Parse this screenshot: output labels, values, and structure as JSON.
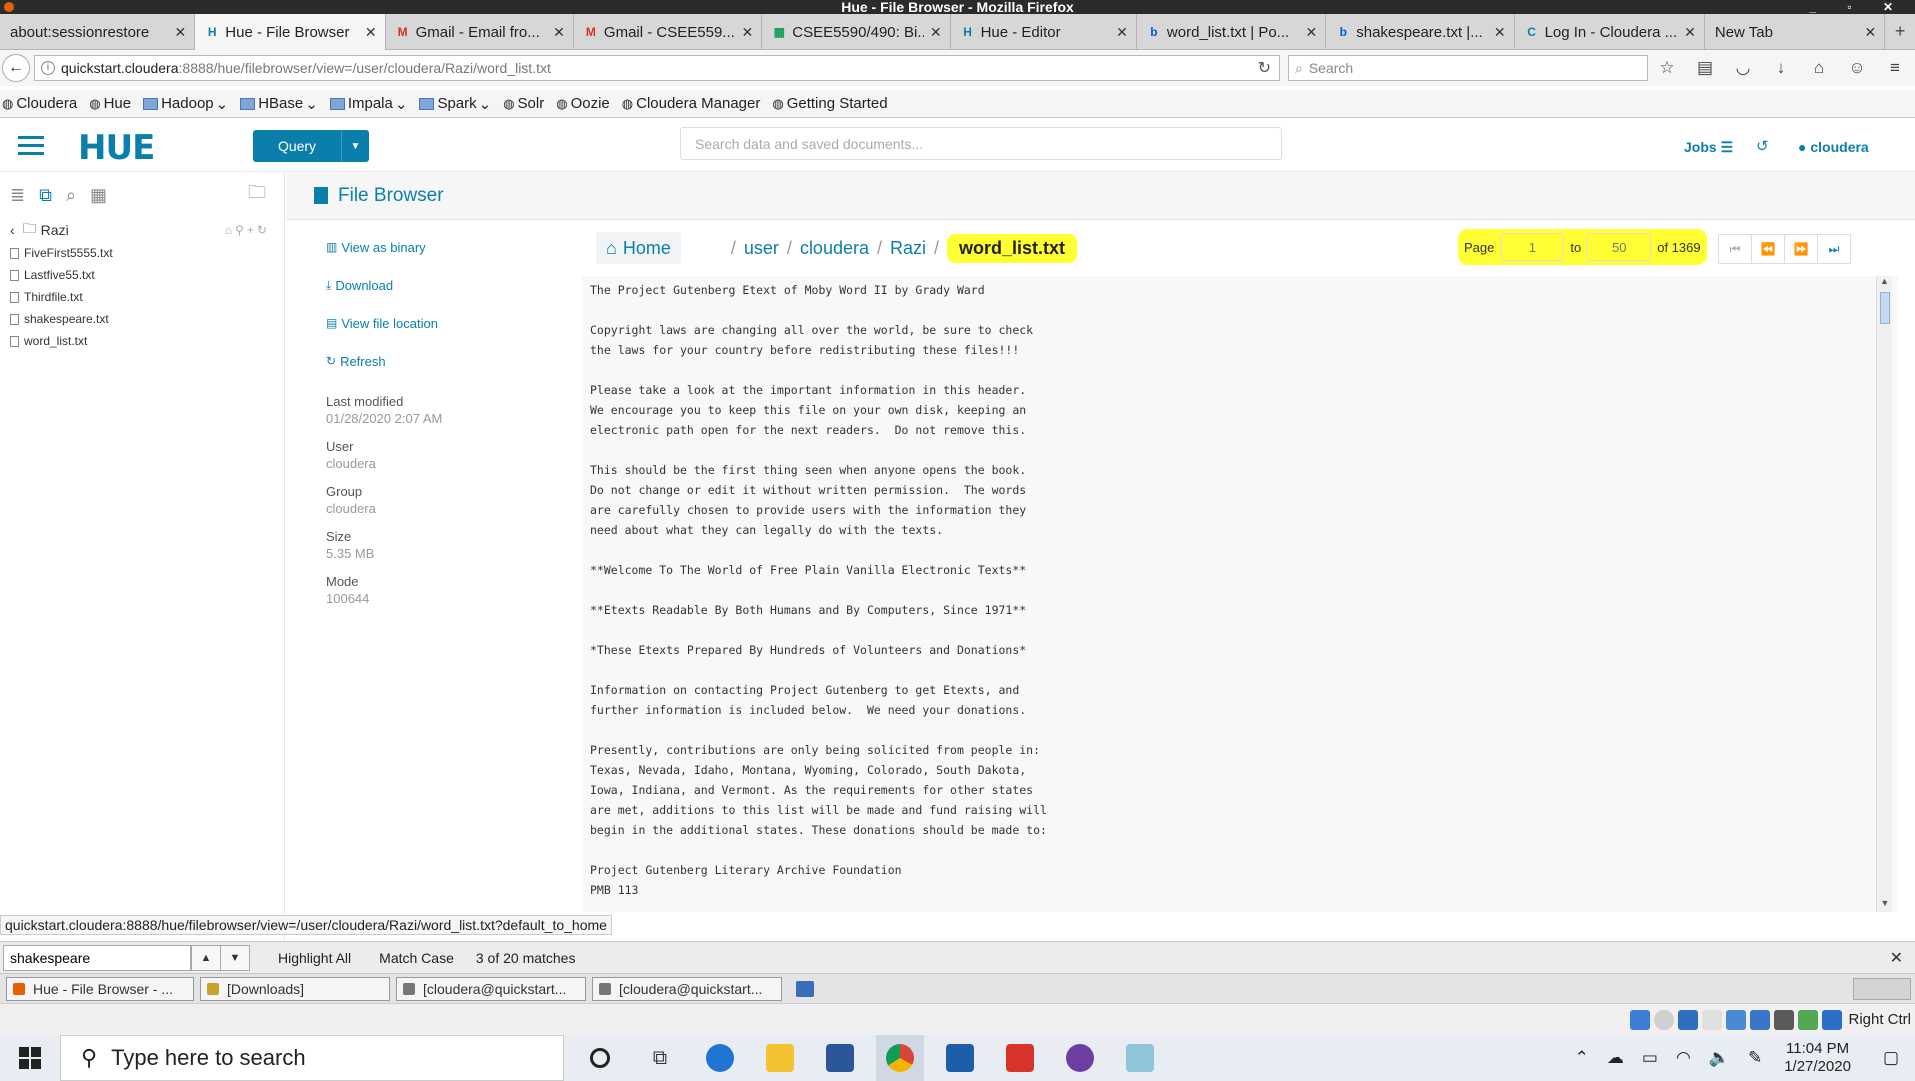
{
  "window": {
    "title": "Hue - File Browser - Mozilla Firefox"
  },
  "tabs": [
    {
      "label": "about:sessionrestore",
      "icon": "none",
      "color": ""
    },
    {
      "label": "Hue - File Browser",
      "icon": "hue",
      "color": "#0b7fab",
      "active": true
    },
    {
      "label": "Gmail - Email fro...",
      "icon": "gmail",
      "color": "#d93025"
    },
    {
      "label": "Gmail - CSEE559...",
      "icon": "gmail",
      "color": "#d93025"
    },
    {
      "label": "CSEE5590/490: Bi...",
      "icon": "sheets",
      "color": "#0f9d58"
    },
    {
      "label": "Hue - Editor",
      "icon": "hue",
      "color": "#0b7fab"
    },
    {
      "label": "word_list.txt | Po...",
      "icon": "box",
      "color": "#0061d5"
    },
    {
      "label": "shakespeare.txt |...",
      "icon": "box",
      "color": "#0061d5"
    },
    {
      "label": "Log In - Cloudera ...",
      "icon": "cloudera",
      "color": "#0b7fab"
    },
    {
      "label": "New Tab",
      "icon": "none",
      "color": ""
    }
  ],
  "url": {
    "host": "quickstart.cloudera",
    "path": ":8888/hue/filebrowser/view=/user/cloudera/Razi/word_list.txt"
  },
  "browser_search": {
    "placeholder": "Search"
  },
  "bookmarks": [
    {
      "label": "Cloudera",
      "type": "site"
    },
    {
      "label": "Hue",
      "type": "site"
    },
    {
      "label": "Hadoop",
      "type": "folder"
    },
    {
      "label": "HBase",
      "type": "folder"
    },
    {
      "label": "Impala",
      "type": "folder"
    },
    {
      "label": "Spark",
      "type": "folder"
    },
    {
      "label": "Solr",
      "type": "site"
    },
    {
      "label": "Oozie",
      "type": "site"
    },
    {
      "label": "Cloudera Manager",
      "type": "site"
    },
    {
      "label": "Getting Started",
      "type": "site"
    }
  ],
  "hue": {
    "logo": "HUE",
    "query_button": "Query",
    "search_placeholder": "Search data and saved documents...",
    "jobs": "Jobs",
    "user": "cloudera"
  },
  "sidebar": {
    "folder": "Razi",
    "files": [
      "FiveFirst5555.txt",
      "Lastfive55.txt",
      "Thirdfile.txt",
      "shakespeare.txt",
      "word_list.txt"
    ]
  },
  "main": {
    "title": "File Browser",
    "actions": {
      "view_binary": "View as binary",
      "download": "Download",
      "view_location": "View file location",
      "refresh": "Refresh"
    },
    "props": {
      "last_modified_label": "Last modified",
      "last_modified": "01/28/2020 2:07 AM",
      "user_label": "User",
      "user": "cloudera",
      "group_label": "Group",
      "group": "cloudera",
      "size_label": "Size",
      "size": "5.35 MB",
      "mode_label": "Mode",
      "mode": "100644"
    },
    "breadcrumb": {
      "home": "Home",
      "parts": [
        "user",
        "cloudera",
        "Razi"
      ],
      "current": "word_list.txt"
    },
    "pager": {
      "page_label": "Page",
      "from": "1",
      "to_label": "to",
      "to": "50",
      "of_label": "of 1369"
    },
    "content": "The Project Gutenberg Etext of Moby Word II by Grady Ward\n\nCopyright laws are changing all over the world, be sure to check\nthe laws for your country before redistributing these files!!!\n\nPlease take a look at the important information in this header.\nWe encourage you to keep this file on your own disk, keeping an\nelectronic path open for the next readers.  Do not remove this.\n\nThis should be the first thing seen when anyone opens the book.\nDo not change or edit it without written permission.  The words\nare carefully chosen to provide users with the information they\nneed about what they can legally do with the texts.\n\n**Welcome To The World of Free Plain Vanilla Electronic Texts**\n\n**Etexts Readable By Both Humans and By Computers, Since 1971**\n\n*These Etexts Prepared By Hundreds of Volunteers and Donations*\n\nInformation on contacting Project Gutenberg to get Etexts, and\nfurther information is included below.  We need your donations.\n\nPresently, contributions are only being solicited from people in:\nTexas, Nevada, Idaho, Montana, Wyoming, Colorado, South Dakota,\nIowa, Indiana, and Vermont. As the requirements for other states\nare met, additions to this list will be made and fund raising will\nbegin in the additional states. These donations should be made to:\n\nProject Gutenberg Literary Archive Foundation\nPMB 113"
  },
  "status_link": "quickstart.cloudera:8888/hue/filebrowser/view=/user/cloudera/Razi/word_list.txt?default_to_home",
  "findbar": {
    "query": "shakespeare",
    "highlight_all": "Highlight All",
    "match_case": "Match Case",
    "matches": "3 of 20 matches"
  },
  "vm_tasks": [
    {
      "label": "Hue - File Browser - ...",
      "color": "#e66000"
    },
    {
      "label": "[Downloads]",
      "color": "#c9a227"
    },
    {
      "label": "[cloudera@quickstart...",
      "color": "#777777"
    },
    {
      "label": "[cloudera@quickstart...",
      "color": "#777777"
    }
  ],
  "vbox": {
    "host_key": "Right Ctrl"
  },
  "windows": {
    "search_placeholder": "Type here to search",
    "time": "11:04 PM",
    "date": "1/27/2020"
  }
}
